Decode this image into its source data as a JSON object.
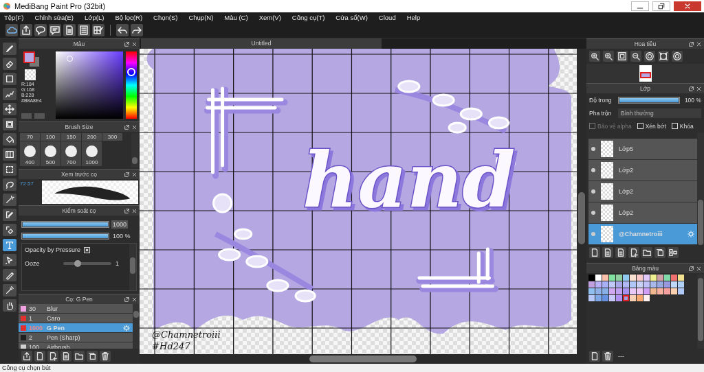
{
  "window": {
    "title": "MediBang Paint Pro (32bit)"
  },
  "menu": [
    "Tệp(F)",
    "Chỉnh sửa(E)",
    "Lớp(L)",
    "Bộ lọc(R)",
    "Chọn(S)",
    "Chụp(N)",
    "Màu (C)",
    "Xem(V)",
    "Công cụ(T)",
    "Cửa sổ(W)",
    "Cloud",
    "Help"
  ],
  "tools": [
    {
      "kind": "brush",
      "selected": false
    },
    {
      "kind": "eraser",
      "selected": false
    },
    {
      "kind": "rect",
      "selected": false
    },
    {
      "kind": "check",
      "selected": false
    },
    {
      "kind": "move",
      "selected": false
    },
    {
      "kind": "fill",
      "selected": false
    },
    {
      "kind": "bucket",
      "selected": false
    },
    {
      "kind": "gradient",
      "selected": false
    },
    {
      "kind": "select",
      "selected": false
    },
    {
      "kind": "lasso",
      "selected": false
    },
    {
      "kind": "wand",
      "selected": false
    },
    {
      "kind": "selpen",
      "selected": false
    },
    {
      "kind": "selerase",
      "selected": false
    },
    {
      "kind": "text",
      "selected": true
    },
    {
      "kind": "pointer",
      "selected": false
    },
    {
      "kind": "knife",
      "selected": false
    },
    {
      "kind": "dropper",
      "selected": false
    },
    {
      "kind": "hand",
      "selected": false
    }
  ],
  "color_panel": {
    "title": "Màu",
    "readout": [
      "R:184",
      "G:168",
      "B:228",
      "#B8A8E4"
    ]
  },
  "brush_size": {
    "title": "Brush Size",
    "small": [
      "70",
      "100",
      "150",
      "200",
      "300"
    ],
    "large": [
      "400",
      "500",
      "700",
      "1000"
    ]
  },
  "brush_preview": {
    "title": "Xem trước cọ",
    "scale": "72.57"
  },
  "brush_control": {
    "title": "Kiểm soát cọ",
    "size": {
      "level": 1,
      "value": "1000"
    },
    "opacity": {
      "level": 1,
      "value": "100 %"
    },
    "option": {
      "label": "Opacity by Pressure",
      "checked": true
    },
    "ooze": {
      "label": "Ooze",
      "level": 0.3,
      "value": "1"
    }
  },
  "brush_list": {
    "title": "Cọ: G Pen",
    "items": [
      {
        "size": "30",
        "name": "Blur",
        "color": "#f0a0e0",
        "selected": false
      },
      {
        "size": "1",
        "name": "Caro",
        "color": "#e03030",
        "selected": false
      },
      {
        "size": "1000",
        "name": "G Pen",
        "color": "#e03030",
        "selected": true
      },
      {
        "size": "2",
        "name": "Pen (Sharp)",
        "color": "#202020",
        "selected": false
      },
      {
        "size": "100",
        "name": "Airbrush",
        "color": "#d0d0d0",
        "selected": false
      }
    ]
  },
  "document_tab": {
    "title": "Untitled"
  },
  "canvas": {
    "lettering": "hand",
    "signature": "@Chamnetroiii",
    "hashtag": "#Hd247"
  },
  "navigator": {
    "title": "Hoa tiêu"
  },
  "layers": {
    "title": "Lớp",
    "opacity_label": "Độ trong",
    "opacity": {
      "level": 1,
      "value": "100 %"
    },
    "blend_label": "Pha trộn",
    "blend": "Bình thường",
    "checks": [
      {
        "label": "Bảo vệ alpha",
        "checked": false,
        "disabled": true
      },
      {
        "label": "Xén bớt",
        "checked": false,
        "disabled": false
      },
      {
        "label": "Khóa",
        "checked": false,
        "disabled": false
      }
    ],
    "items": [
      {
        "name": "Lớp5",
        "selected": false
      },
      {
        "name": "Lớp2",
        "selected": false
      },
      {
        "name": "Lớp2",
        "selected": false
      },
      {
        "name": "Lớp2",
        "selected": false
      },
      {
        "name": "@Chamnetroiii",
        "selected": true
      }
    ]
  },
  "palette": {
    "title": "Bảng màu",
    "footer": "---",
    "colors": [
      {
        "color": "#000000",
        "selected": false
      },
      {
        "color": "#ffffff",
        "selected": false
      },
      {
        "color": "#f8c0a8",
        "selected": false
      },
      {
        "color": "#80e0a0",
        "selected": false
      },
      {
        "color": "#90d0a0",
        "selected": false
      },
      {
        "color": "#90c8f0",
        "selected": false
      },
      {
        "color": "#f8e0d0",
        "selected": false
      },
      {
        "color": "#f8c8c8",
        "selected": false
      },
      {
        "color": "#e0c8f8",
        "selected": false
      },
      {
        "color": "#f0f090",
        "selected": false
      },
      {
        "color": "#d0a0a8",
        "selected": false
      },
      {
        "color": "#80d8a8",
        "selected": false
      },
      {
        "color": "#f07070",
        "selected": false
      },
      {
        "color": "#f0e090",
        "selected": false
      },
      {
        "color": "#c0a0e0",
        "selected": false
      },
      {
        "color": "#b8b0f8",
        "selected": false
      },
      {
        "color": "#a8b0f8",
        "selected": false
      },
      {
        "color": "#c0c8f8",
        "selected": false
      },
      {
        "color": "#a8a8e8",
        "selected": false
      },
      {
        "color": "#b0b8f8",
        "selected": false
      },
      {
        "color": "#b0c8f8",
        "selected": false
      },
      {
        "color": "#c8d0f8",
        "selected": false
      },
      {
        "color": "#c0c0f8",
        "selected": false
      },
      {
        "color": "#a8b8e8",
        "selected": false
      },
      {
        "color": "#98a8e0",
        "selected": false
      },
      {
        "color": "#9898e0",
        "selected": false
      },
      {
        "color": "#c0d8f8",
        "selected": false
      },
      {
        "color": "#b0d0f8",
        "selected": false
      },
      {
        "color": "#90c0f0",
        "selected": false
      },
      {
        "color": "#90b0e8",
        "selected": false
      },
      {
        "color": "#88b0e8",
        "selected": false
      },
      {
        "color": "#d0a8f0",
        "selected": false
      },
      {
        "color": "#c0a0f0",
        "selected": false
      },
      {
        "color": "#a890f0",
        "selected": false
      },
      {
        "color": "#e8c8f8",
        "selected": false
      },
      {
        "color": "#f0c8f8",
        "selected": false
      },
      {
        "color": "#d0a0f8",
        "selected": false
      },
      {
        "color": "#f0b890",
        "selected": false
      },
      {
        "color": "#f8b0a0",
        "selected": false
      },
      {
        "color": "#f8a0a0",
        "selected": false
      },
      {
        "color": "#f8d0b0",
        "selected": false
      },
      {
        "color": "#b0c8f8",
        "selected": false
      },
      {
        "color": "#b8c8f8",
        "selected": false
      },
      {
        "color": "#80a8e8",
        "selected": false
      },
      {
        "color": "#6890e0",
        "selected": false
      },
      {
        "color": "#c8c8f8",
        "selected": false
      },
      {
        "color": "#b090f0",
        "selected": false
      },
      {
        "color": "#a0a0e0",
        "selected": true
      },
      {
        "color": "#f8d0b8",
        "selected": false
      },
      {
        "color": "#f8a870",
        "selected": false
      },
      {
        "color": "#fff0f0",
        "selected": false
      }
    ]
  },
  "status_bar": "Công cụ chọn bút"
}
